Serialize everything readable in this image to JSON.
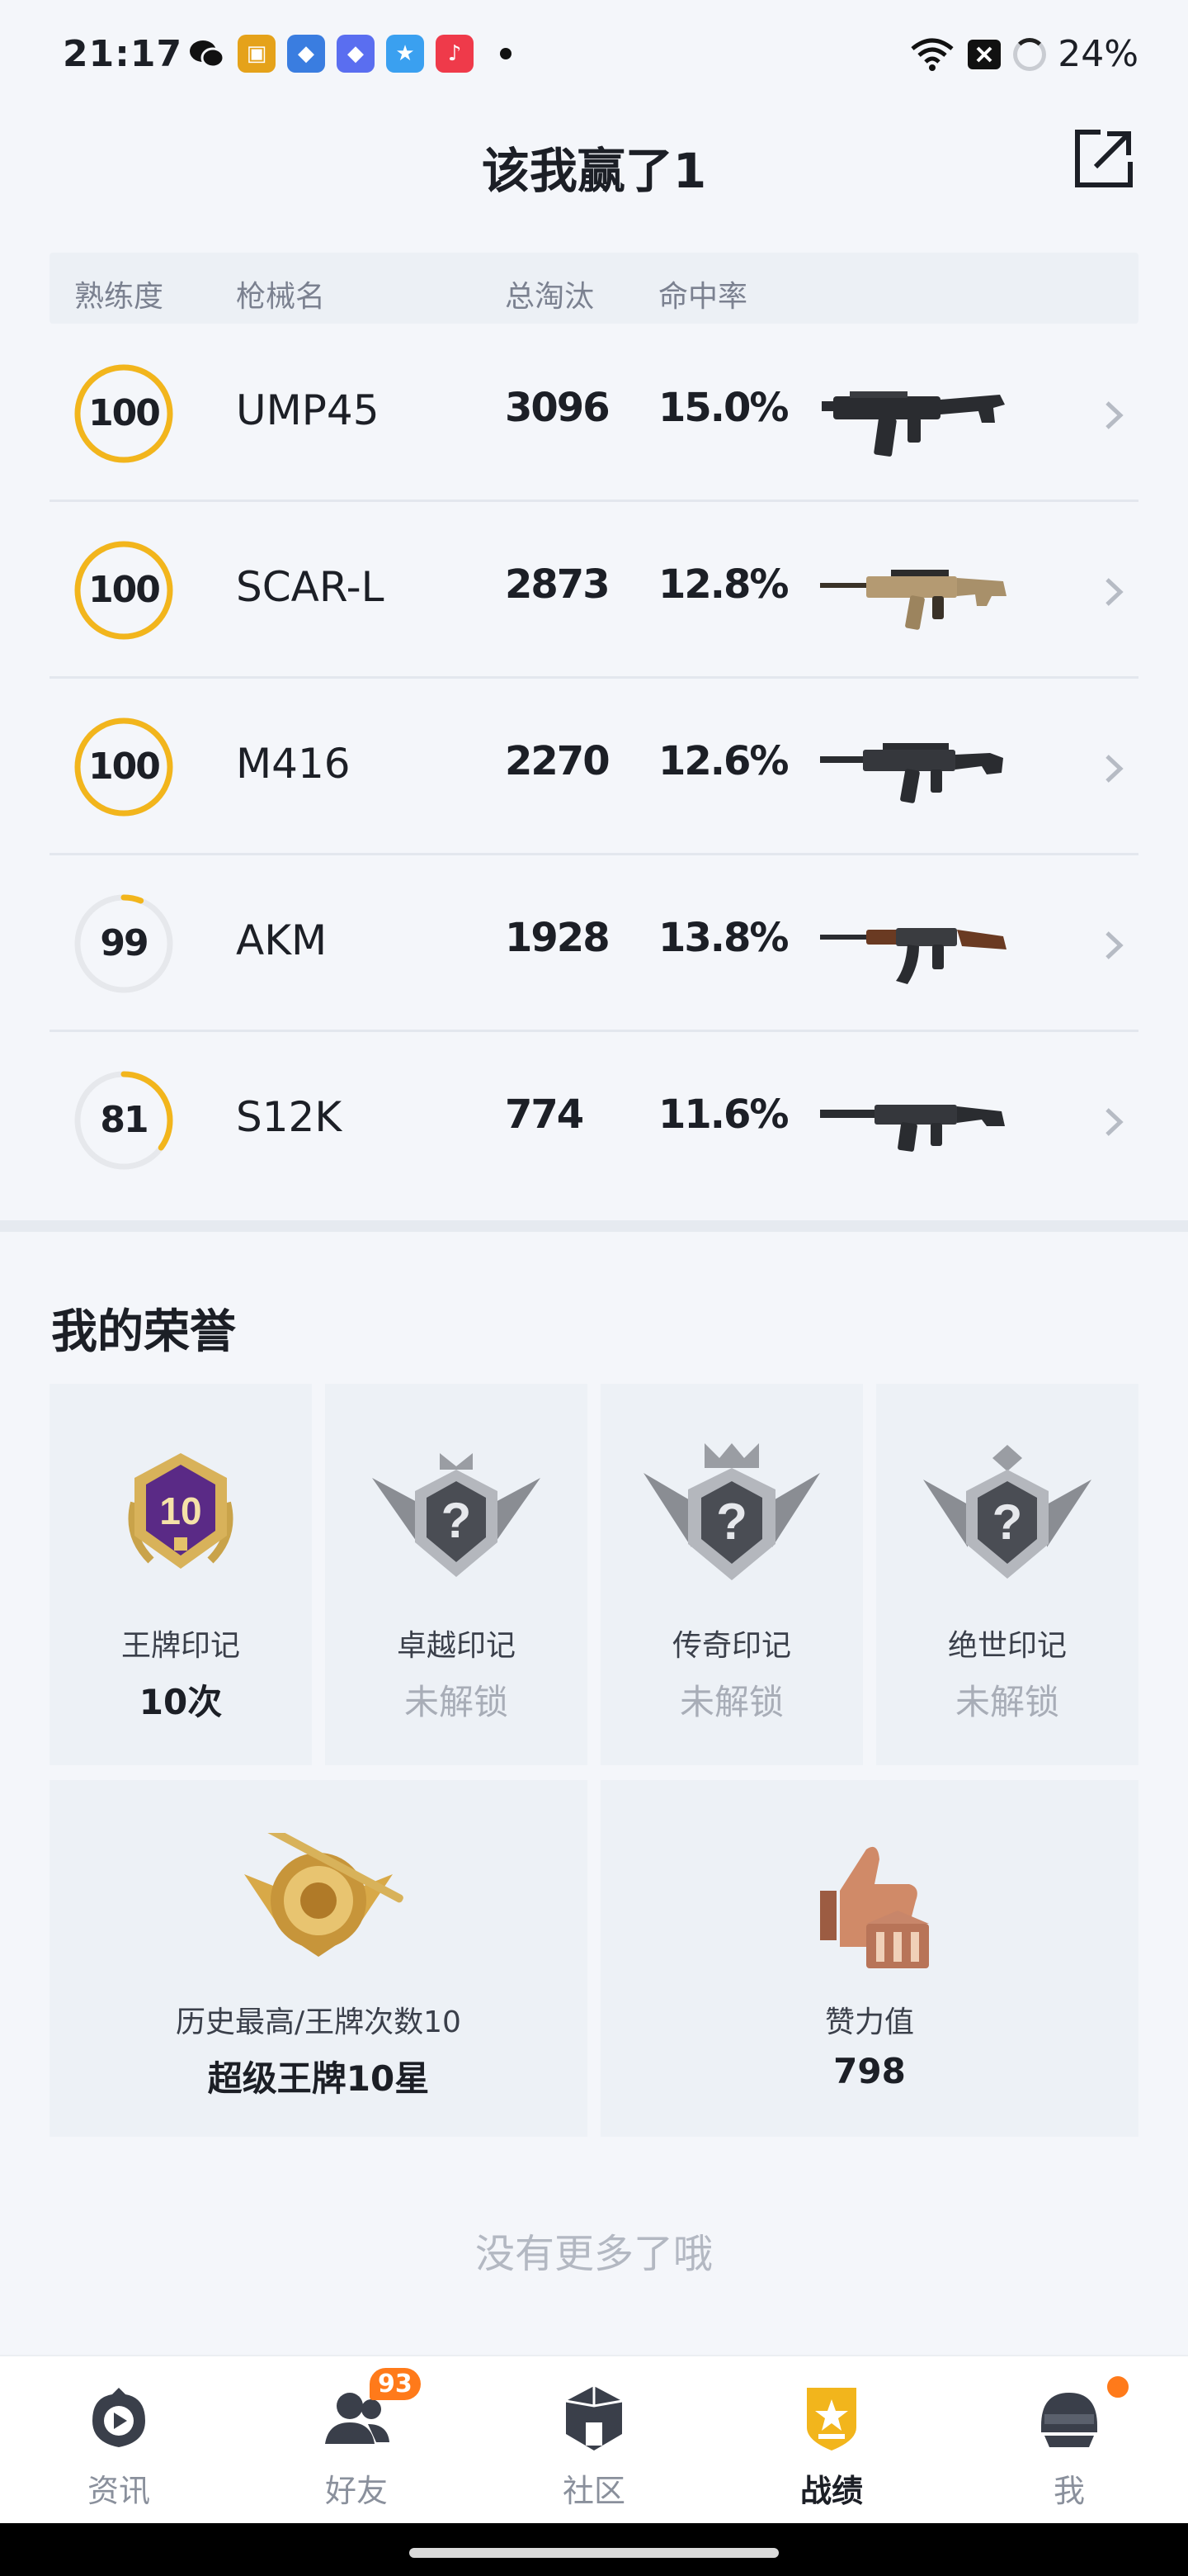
{
  "status_bar": {
    "time": "21:17",
    "battery": "24%",
    "apps": [
      {
        "icon": "wechat-icon",
        "color": "#111111",
        "glyph": "●"
      },
      {
        "icon": "game-app-icon",
        "color": "#e5a21a",
        "glyph": "▣"
      },
      {
        "icon": "game-app-icon",
        "color": "#3a7de0",
        "glyph": "◆"
      },
      {
        "icon": "game-app-icon",
        "color": "#5a6ef0",
        "glyph": "◆"
      },
      {
        "icon": "star-app-icon",
        "color": "#3aa0f0",
        "glyph": "★"
      },
      {
        "icon": "music-app-icon",
        "color": "#ef3a4a",
        "glyph": "♪"
      }
    ]
  },
  "header": {
    "title": "该我赢了1"
  },
  "weapon_table": {
    "columns": [
      "熟练度",
      "枪械名",
      "总淘汰",
      "命中率"
    ],
    "rows": [
      {
        "proficiency": "100",
        "progress": 1.0,
        "name": "UMP45",
        "kills": "3096",
        "hit_rate": "15.0%",
        "gun": "smg"
      },
      {
        "proficiency": "100",
        "progress": 1.0,
        "name": "SCAR-L",
        "kills": "2873",
        "hit_rate": "12.8%",
        "gun": "scar"
      },
      {
        "proficiency": "100",
        "progress": 1.0,
        "name": "M416",
        "kills": "2270",
        "hit_rate": "12.6%",
        "gun": "m416"
      },
      {
        "proficiency": "99",
        "progress": 0.06,
        "name": "AKM",
        "kills": "1928",
        "hit_rate": "13.8%",
        "gun": "akm"
      },
      {
        "proficiency": "81",
        "progress": 0.35,
        "name": "S12K",
        "kills": "774",
        "hit_rate": "11.6%",
        "gun": "shotgun"
      }
    ]
  },
  "honors": {
    "title": "我的荣誉",
    "marks": [
      {
        "label": "王牌印记",
        "value": "10次",
        "locked": false,
        "icon": "ace-mark-badge-icon"
      },
      {
        "label": "卓越印记",
        "value": "未解锁",
        "locked": true,
        "icon": "excellence-mark-badge-icon"
      },
      {
        "label": "传奇印记",
        "value": "未解锁",
        "locked": true,
        "icon": "legend-mark-badge-icon"
      },
      {
        "label": "绝世印记",
        "value": "未解锁",
        "locked": true,
        "icon": "peerless-mark-badge-icon"
      }
    ],
    "highest": {
      "label": "历史最高/王牌次数10",
      "value": "超级王牌10星",
      "icon": "super-ace-rank-icon"
    },
    "likes": {
      "label": "赞力值",
      "value": "798",
      "icon": "thumbs-up-trophy-icon"
    }
  },
  "footer_text": "没有更多了哦",
  "bottom_nav": {
    "items": [
      {
        "label": "资讯",
        "icon": "news-icon",
        "active": false
      },
      {
        "label": "好友",
        "icon": "friends-icon",
        "active": false,
        "badge": "93"
      },
      {
        "label": "社区",
        "icon": "community-icon",
        "active": false
      },
      {
        "label": "战绩",
        "icon": "records-icon",
        "active": true
      },
      {
        "label": "我",
        "icon": "profile-helmet-icon",
        "active": false,
        "dot": true
      }
    ]
  },
  "colors": {
    "accent": "#f2b51c",
    "ring_track": "#e6e8ec",
    "notification": "#ff7a1a"
  }
}
